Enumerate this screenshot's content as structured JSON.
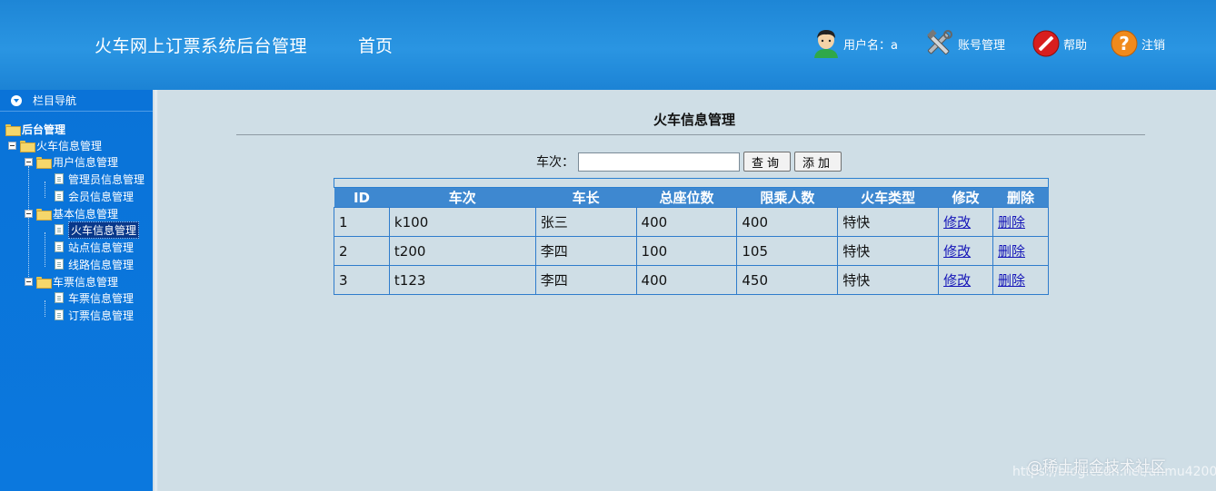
{
  "header": {
    "title": "火车网上订票系统后台管理",
    "home": "首页",
    "user_label": "用户名：a",
    "account": "账号管理",
    "help": "帮助",
    "logout": "注销"
  },
  "sidebar": {
    "nav_title": "栏目导航",
    "root": "后台管理",
    "train_mgmt": "火车信息管理",
    "user_mgmt": "用户信息管理",
    "admin_mgmt": "管理员信息管理",
    "member_mgmt": "会员信息管理",
    "basic_mgmt": "基本信息管理",
    "train_info": "火车信息管理",
    "station_info": "站点信息管理",
    "route_info": "线路信息管理",
    "ticket_mgmt": "车票信息管理",
    "ticket_info": "车票信息管理",
    "order_info": "订票信息管理"
  },
  "main": {
    "title": "火车信息管理",
    "search_label": "车次：",
    "search_value": "",
    "query_btn": "查询",
    "add_btn": "添加",
    "columns": [
      "ID",
      "车次",
      "车长",
      "总座位数",
      "限乘人数",
      "火车类型",
      "修改",
      "删除"
    ],
    "rows": [
      {
        "id": "1",
        "train": "k100",
        "conductor": "张三",
        "seats": "400",
        "limit": "400",
        "type": "特快",
        "edit": "修改",
        "del": "删除"
      },
      {
        "id": "2",
        "train": "t200",
        "conductor": "李四",
        "seats": "100",
        "limit": "105",
        "type": "特快",
        "edit": "修改",
        "del": "删除"
      },
      {
        "id": "3",
        "train": "t123",
        "conductor": "李四",
        "seats": "400",
        "limit": "450",
        "type": "特快",
        "edit": "修改",
        "del": "删除"
      }
    ]
  },
  "watermark": {
    "line1": "@稀土掘金技术社区",
    "line2": "https://blog.csdn.net/anmu4200"
  }
}
